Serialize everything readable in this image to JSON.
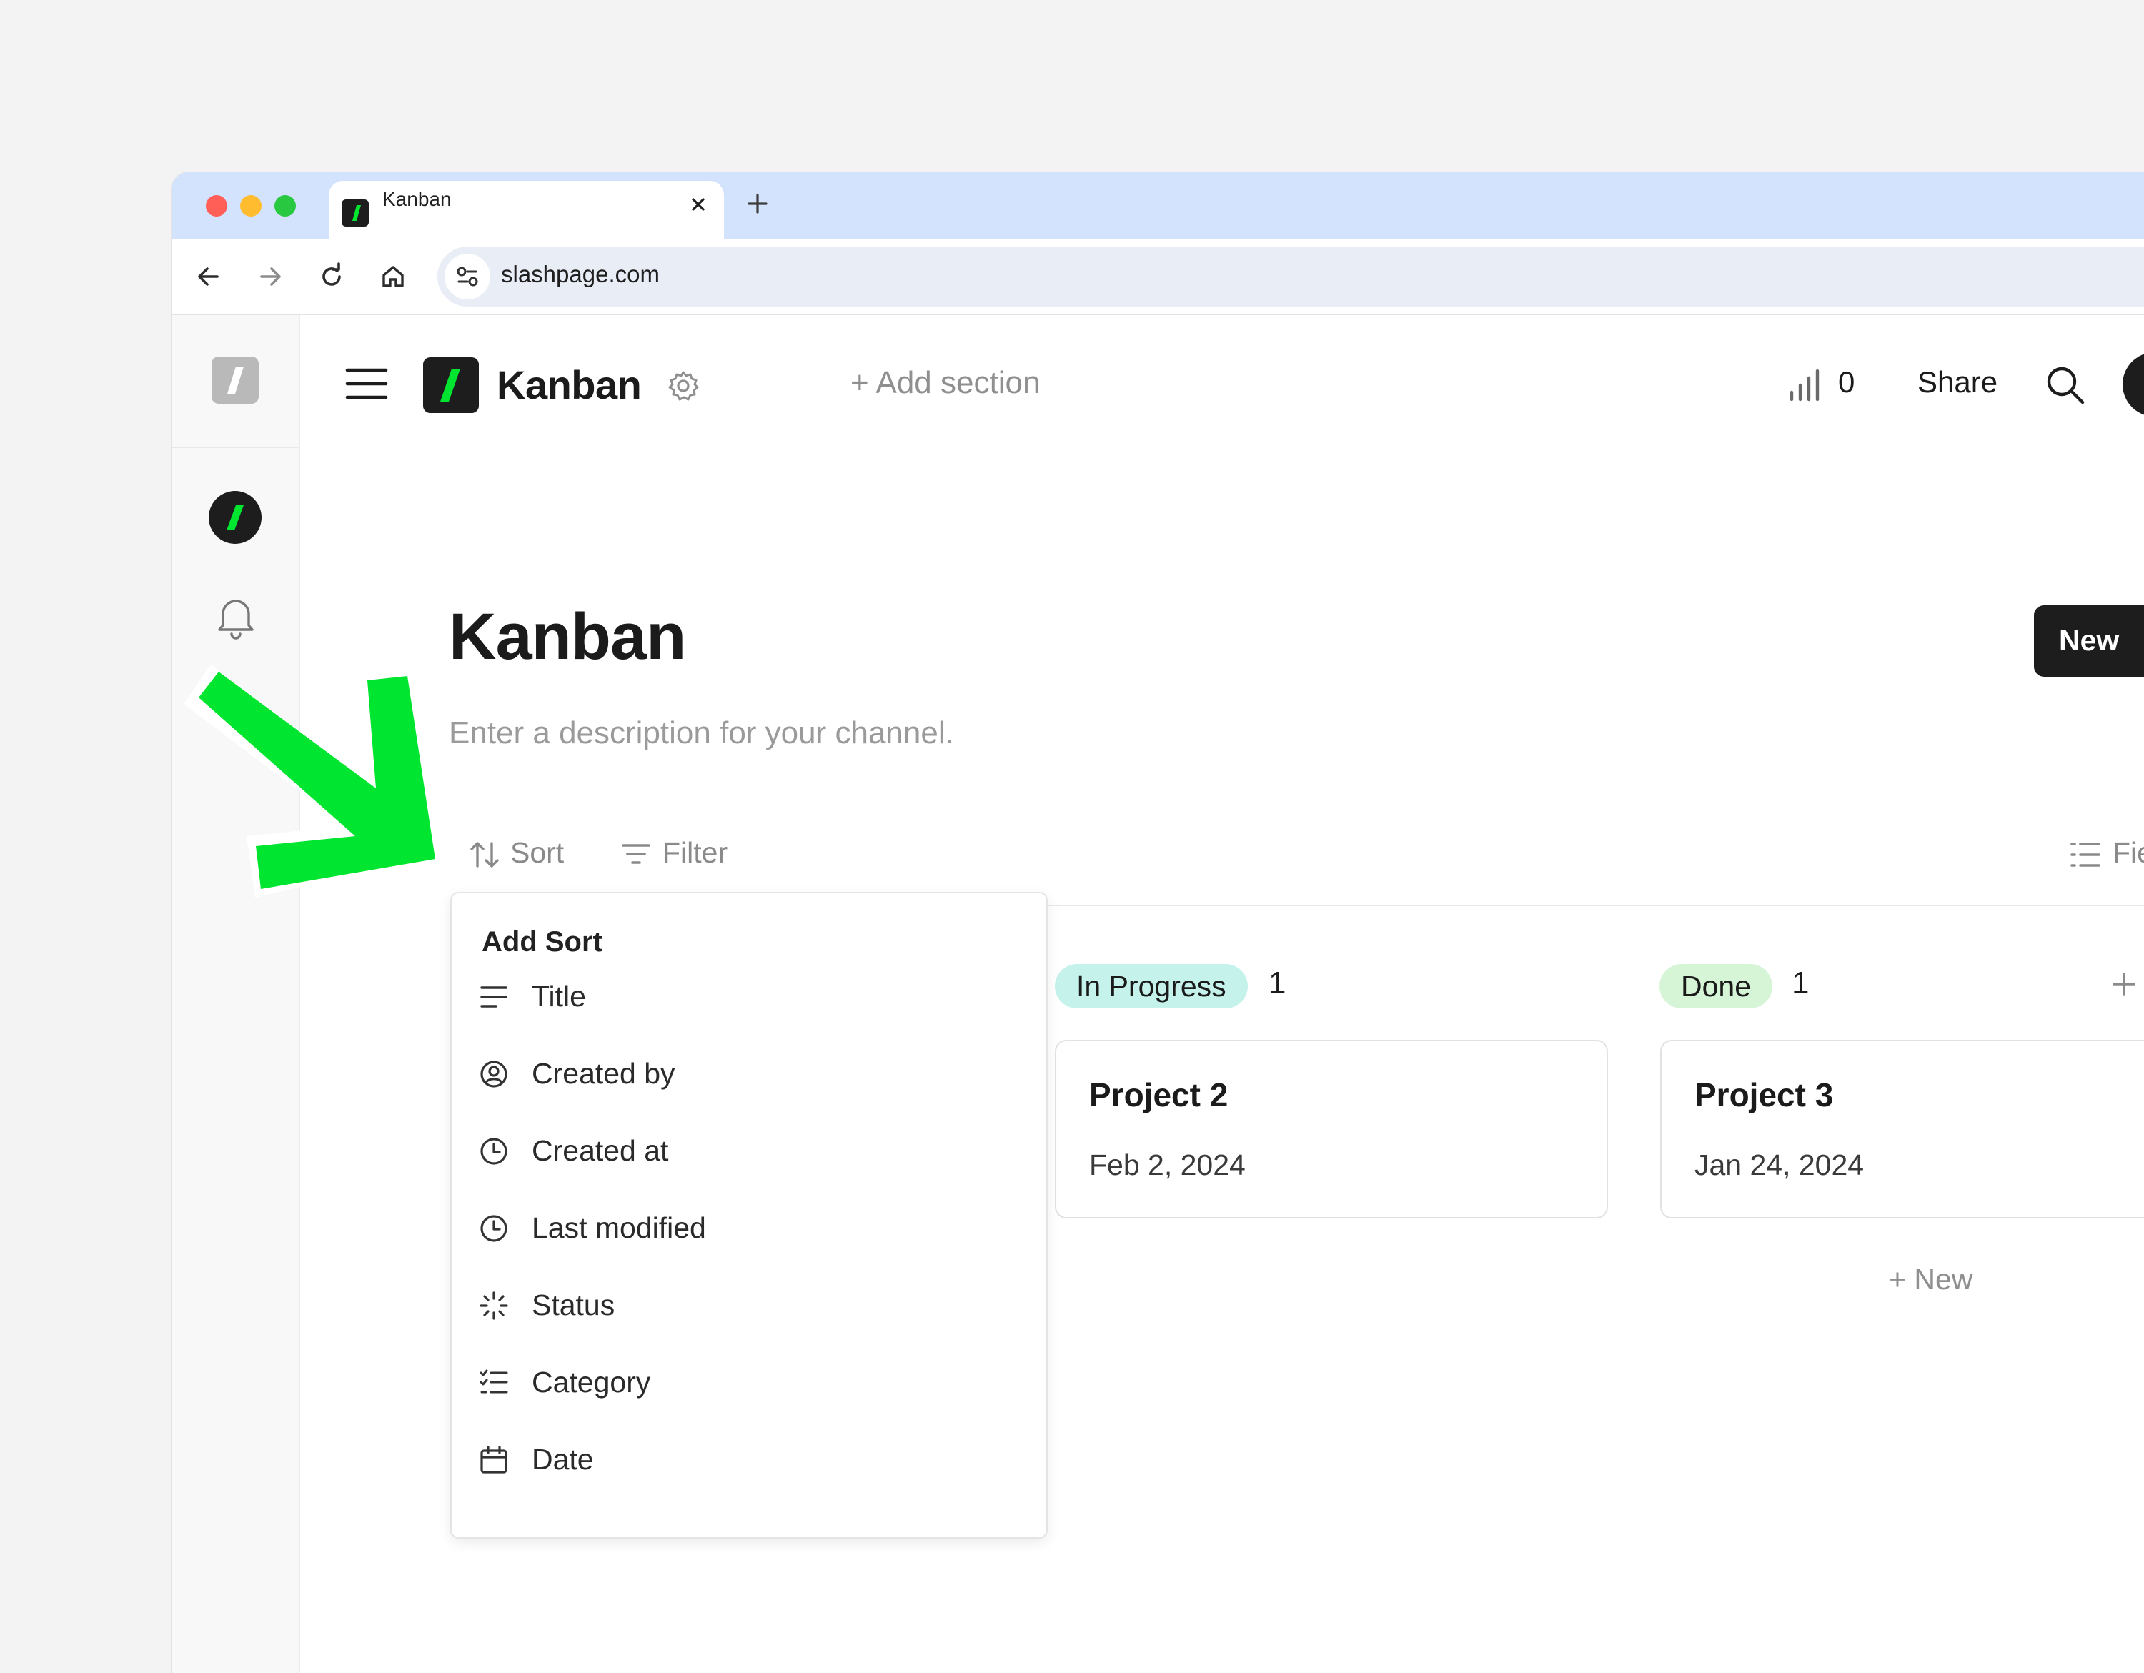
{
  "browser": {
    "tab_title": "Kanban",
    "url": "slashpage.com"
  },
  "header": {
    "title": "Kanban",
    "add_section": "+ Add section",
    "views_count": "0",
    "share": "Share",
    "new_button": "New"
  },
  "page": {
    "title": "Kanban",
    "description_placeholder": "Enter a description for your channel."
  },
  "toolbar": {
    "sort": "Sort",
    "filter": "Filter",
    "fields": "Fie"
  },
  "sort_menu": {
    "heading": "Add Sort",
    "items": [
      {
        "label": "Title",
        "icon": "text-lines-icon"
      },
      {
        "label": "Created by",
        "icon": "user-circle-icon"
      },
      {
        "label": "Created at",
        "icon": "clock-icon"
      },
      {
        "label": "Last modified",
        "icon": "clock-icon"
      },
      {
        "label": "Status",
        "icon": "loader-icon"
      },
      {
        "label": "Category",
        "icon": "checklist-icon"
      },
      {
        "label": "Date",
        "icon": "calendar-icon"
      }
    ]
  },
  "board": {
    "columns": [
      {
        "status": "In Progress",
        "count": "1",
        "color": "#c5f3ec",
        "cards": [
          {
            "title": "Project 2",
            "date": "Feb 2, 2024"
          }
        ]
      },
      {
        "status": "Done",
        "count": "1",
        "color": "#d6f5d6",
        "cards": [
          {
            "title": "Project 3",
            "date": "Jan 24, 2024"
          }
        ],
        "new_label": "+ New"
      }
    ]
  },
  "colors": {
    "brand_green": "#00e52f",
    "annotation_arrow": "#00e52f"
  }
}
